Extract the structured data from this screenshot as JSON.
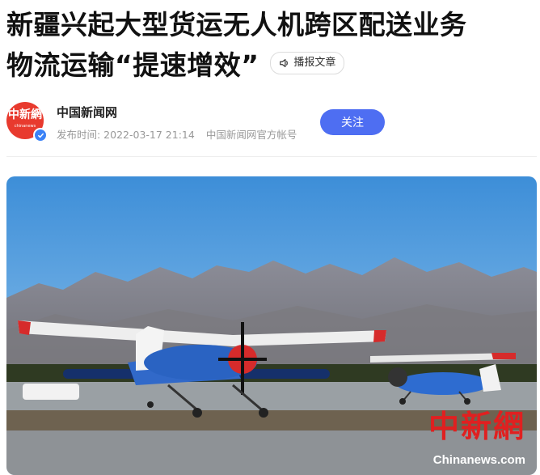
{
  "article": {
    "title_line1": "新疆兴起大型货运无人机跨区配送业务",
    "title_line2": "物流运输“提速增效”",
    "listen_label": "播报文章"
  },
  "author": {
    "avatar_text": "中新網",
    "avatar_sub": "chinanews",
    "name": "中国新闻网",
    "published": "发布时间: 2022-03-17 21:14",
    "account": "中国新闻网官方帐号",
    "follow_label": "关注"
  },
  "photo": {
    "watermark": "中新網",
    "watermark_url": "Chinanews.com"
  },
  "colors": {
    "accent": "#4e6ef2",
    "avatar_red": "#e83a2e",
    "watermark_red": "#e02020"
  }
}
